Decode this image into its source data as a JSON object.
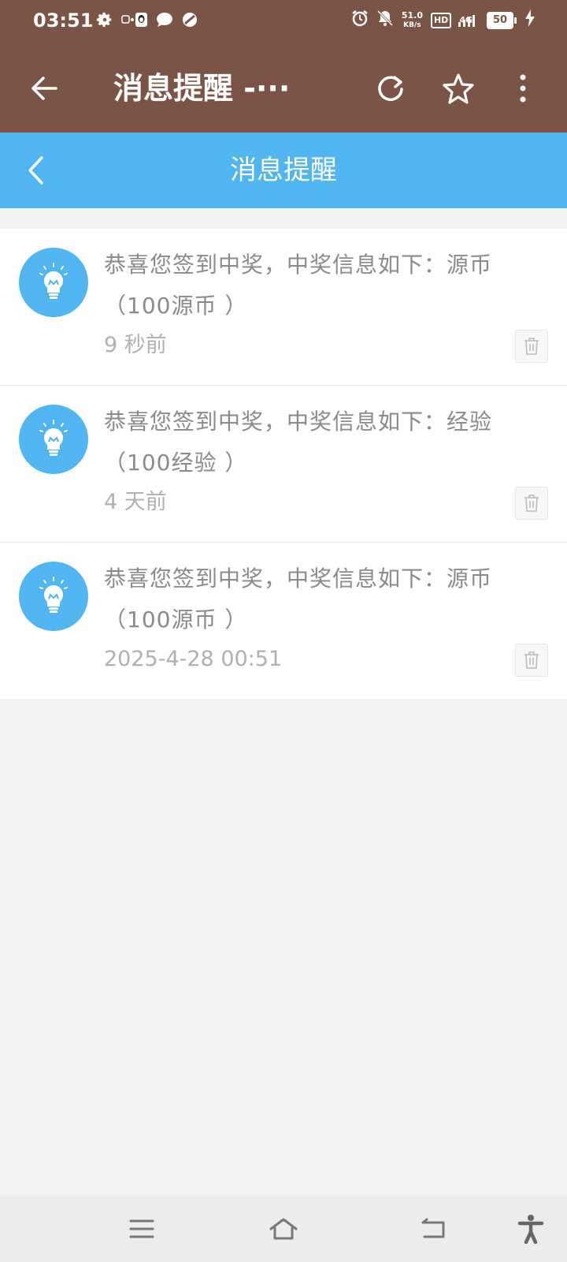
{
  "status_bar": {
    "time": "03:51",
    "net_speed_value": "51.0",
    "net_speed_unit": "KB/s",
    "hd_label": "HD",
    "network_label": "4G",
    "battery_level": "50"
  },
  "toolbar": {
    "title": "消息提醒 -···"
  },
  "page_header": {
    "title": "消息提醒"
  },
  "messages": [
    {
      "line1": "恭喜您签到中奖，中奖信息如下：源币",
      "line2": "（100源币 ）",
      "time": "9 秒前"
    },
    {
      "line1": "恭喜您签到中奖，中奖信息如下：经验",
      "line2": "（100经验 ）",
      "time": "4 天前"
    },
    {
      "line1": "恭喜您签到中奖，中奖信息如下：源币",
      "line2": "（100源币 ）",
      "time": "2025-4-28 00:51"
    }
  ],
  "colors": {
    "toolbar_bg": "#7b5446",
    "header_bg": "#50b5f0",
    "page_bg": "#f2f2f2",
    "text_primary": "#8a8a8a",
    "text_secondary": "#b0b0b0"
  },
  "icons": {
    "back": "arrow-left-icon",
    "refresh": "refresh-icon",
    "star": "star-icon",
    "more": "more-vertical-icon",
    "header_back": "chevron-left-icon",
    "avatar": "lightbulb-icon",
    "delete": "trash-icon",
    "nav_menu": "menu-icon",
    "nav_home": "home-icon",
    "nav_back": "back-return-icon",
    "accessibility": "accessibility-icon"
  }
}
